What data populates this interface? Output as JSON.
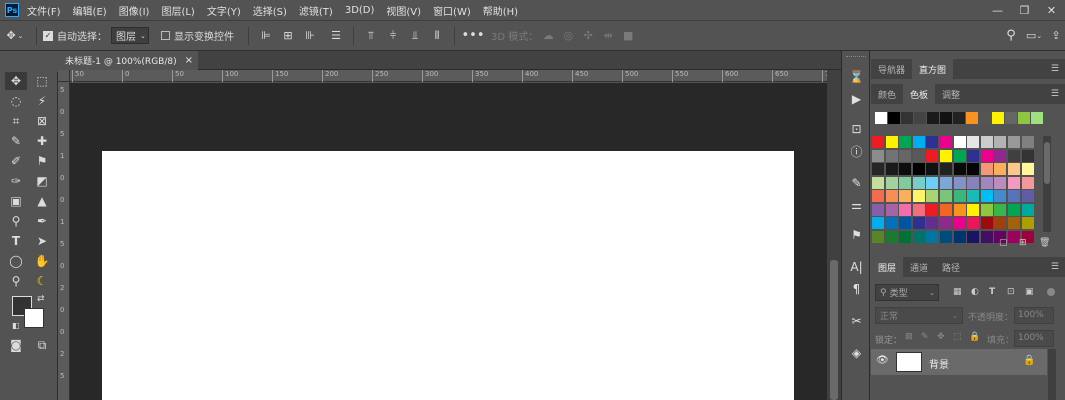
{
  "app": {
    "logo": "Ps"
  },
  "menu": [
    "文件(F)",
    "编辑(E)",
    "图像(I)",
    "图层(L)",
    "文字(Y)",
    "选择(S)",
    "滤镜(T)",
    "3D(D)",
    "视图(V)",
    "窗口(W)",
    "帮助(H)"
  ],
  "window_controls": {
    "minimize": "—",
    "restore": "❐",
    "close": "✕"
  },
  "options": {
    "auto_select_label": "自动选择：",
    "auto_select_value": "图层",
    "show_transform_label": "显示变换控件",
    "mode3d_label": "3D 模式："
  },
  "document": {
    "tab_title": "未标题-1 @ 100%(RGB/8)",
    "close": "×"
  },
  "ruler": {
    "top_labels": [
      "50",
      "0",
      "50",
      "100",
      "150",
      "200",
      "250",
      "300",
      "350",
      "400",
      "450",
      "500",
      "550",
      "600",
      "650",
      "700"
    ],
    "left_labels": [
      "5",
      "0",
      "5",
      "1",
      "0",
      "0",
      "1",
      "5",
      "0",
      "2",
      "0",
      "0",
      "2",
      "5"
    ]
  },
  "panels": {
    "top": {
      "tabs": [
        "导航器",
        "直方图"
      ],
      "active": "直方图"
    },
    "swatch": {
      "tabs": [
        "颜色",
        "色板",
        "调整"
      ],
      "active": "色板",
      "recent_colors": [
        "#ffffff",
        "#000000",
        "#333333",
        "#444444",
        "#1a1a1a",
        "#111111",
        "#222222",
        "#f7931e",
        "#555555",
        "#fff200",
        "#666666",
        "#8dc63f",
        "#a0e080"
      ],
      "grid": [
        [
          "#ed1c24",
          "#fff200",
          "#00a651",
          "#00aeef",
          "#2e3192",
          "#ec008c",
          "#ffffff",
          "#e6e6e6",
          "#cccccc",
          "#b3b3b3",
          "#999999",
          "#808080"
        ],
        [
          "#8c8c8c",
          "#737373",
          "#666666",
          "#595959",
          "#ed1c24",
          "#fff200",
          "#00a651",
          "#2e3192",
          "#ec008c",
          "#92278f",
          "#404040",
          "#333333"
        ],
        [
          "#262626",
          "#1a1a1a",
          "#0d0d0d",
          "#000000",
          "#111111",
          "#222222",
          "#0a0a0a",
          "#050505",
          "#f69679",
          "#fbaf5d",
          "#fdc68a",
          "#fff799"
        ],
        [
          "#c4df9b",
          "#a3d39c",
          "#82ca9c",
          "#7accc8",
          "#6dcff6",
          "#7da7d9",
          "#8393ca",
          "#8781bd",
          "#a187be",
          "#bd8cbf",
          "#f49ac1",
          "#f5989d"
        ],
        [
          "#f26c4f",
          "#f68e55",
          "#fbaf5c",
          "#fff467",
          "#acd372",
          "#7cc576",
          "#3bb878",
          "#1abbb4",
          "#00bff3",
          "#438ccb",
          "#5574b9",
          "#605ca8"
        ],
        [
          "#855fa8",
          "#a763a8",
          "#f06ea9",
          "#f26d7d",
          "#ed1c24",
          "#f26522",
          "#f7941d",
          "#fff200",
          "#8dc63f",
          "#39b54a",
          "#00a651",
          "#00a99d"
        ],
        [
          "#00aeef",
          "#0072bc",
          "#0054a6",
          "#2e3192",
          "#662d91",
          "#92278f",
          "#ec008c",
          "#ed145b",
          "#9e0b0f",
          "#a0410d",
          "#a3620a",
          "#aba000"
        ],
        [
          "#598527",
          "#1a7b30",
          "#007236",
          "#00746b",
          "#0076a3",
          "#004b80",
          "#003471",
          "#1b1464",
          "#440e62",
          "#630460",
          "#9e005d",
          "#9e0039"
        ]
      ]
    },
    "layers": {
      "tabs": [
        "图层",
        "通道",
        "路径"
      ],
      "active": "图层",
      "filter_placeholder": "类型",
      "blend_mode": "正常",
      "opacity_label": "不透明度：",
      "opacity_value": "100%",
      "lock_label": "锁定：",
      "fill_label": "填充：",
      "fill_value": "100%",
      "layer_name": "背景"
    }
  }
}
